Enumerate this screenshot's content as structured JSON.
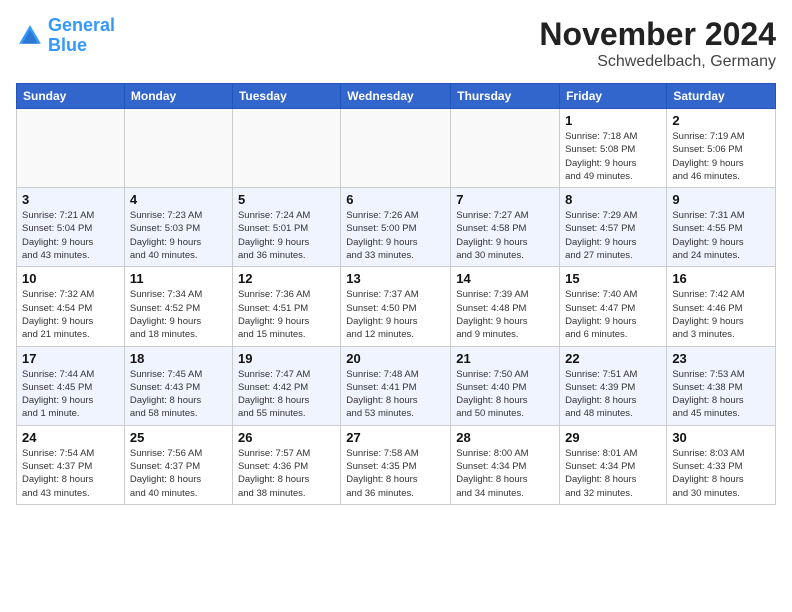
{
  "header": {
    "logo_line1": "General",
    "logo_line2": "Blue",
    "month_title": "November 2024",
    "location": "Schwedelbach, Germany"
  },
  "weekdays": [
    "Sunday",
    "Monday",
    "Tuesday",
    "Wednesday",
    "Thursday",
    "Friday",
    "Saturday"
  ],
  "weeks": [
    [
      {
        "day": "",
        "info": ""
      },
      {
        "day": "",
        "info": ""
      },
      {
        "day": "",
        "info": ""
      },
      {
        "day": "",
        "info": ""
      },
      {
        "day": "",
        "info": ""
      },
      {
        "day": "1",
        "info": "Sunrise: 7:18 AM\nSunset: 5:08 PM\nDaylight: 9 hours\nand 49 minutes."
      },
      {
        "day": "2",
        "info": "Sunrise: 7:19 AM\nSunset: 5:06 PM\nDaylight: 9 hours\nand 46 minutes."
      }
    ],
    [
      {
        "day": "3",
        "info": "Sunrise: 7:21 AM\nSunset: 5:04 PM\nDaylight: 9 hours\nand 43 minutes."
      },
      {
        "day": "4",
        "info": "Sunrise: 7:23 AM\nSunset: 5:03 PM\nDaylight: 9 hours\nand 40 minutes."
      },
      {
        "day": "5",
        "info": "Sunrise: 7:24 AM\nSunset: 5:01 PM\nDaylight: 9 hours\nand 36 minutes."
      },
      {
        "day": "6",
        "info": "Sunrise: 7:26 AM\nSunset: 5:00 PM\nDaylight: 9 hours\nand 33 minutes."
      },
      {
        "day": "7",
        "info": "Sunrise: 7:27 AM\nSunset: 4:58 PM\nDaylight: 9 hours\nand 30 minutes."
      },
      {
        "day": "8",
        "info": "Sunrise: 7:29 AM\nSunset: 4:57 PM\nDaylight: 9 hours\nand 27 minutes."
      },
      {
        "day": "9",
        "info": "Sunrise: 7:31 AM\nSunset: 4:55 PM\nDaylight: 9 hours\nand 24 minutes."
      }
    ],
    [
      {
        "day": "10",
        "info": "Sunrise: 7:32 AM\nSunset: 4:54 PM\nDaylight: 9 hours\nand 21 minutes."
      },
      {
        "day": "11",
        "info": "Sunrise: 7:34 AM\nSunset: 4:52 PM\nDaylight: 9 hours\nand 18 minutes."
      },
      {
        "day": "12",
        "info": "Sunrise: 7:36 AM\nSunset: 4:51 PM\nDaylight: 9 hours\nand 15 minutes."
      },
      {
        "day": "13",
        "info": "Sunrise: 7:37 AM\nSunset: 4:50 PM\nDaylight: 9 hours\nand 12 minutes."
      },
      {
        "day": "14",
        "info": "Sunrise: 7:39 AM\nSunset: 4:48 PM\nDaylight: 9 hours\nand 9 minutes."
      },
      {
        "day": "15",
        "info": "Sunrise: 7:40 AM\nSunset: 4:47 PM\nDaylight: 9 hours\nand 6 minutes."
      },
      {
        "day": "16",
        "info": "Sunrise: 7:42 AM\nSunset: 4:46 PM\nDaylight: 9 hours\nand 3 minutes."
      }
    ],
    [
      {
        "day": "17",
        "info": "Sunrise: 7:44 AM\nSunset: 4:45 PM\nDaylight: 9 hours\nand 1 minute."
      },
      {
        "day": "18",
        "info": "Sunrise: 7:45 AM\nSunset: 4:43 PM\nDaylight: 8 hours\nand 58 minutes."
      },
      {
        "day": "19",
        "info": "Sunrise: 7:47 AM\nSunset: 4:42 PM\nDaylight: 8 hours\nand 55 minutes."
      },
      {
        "day": "20",
        "info": "Sunrise: 7:48 AM\nSunset: 4:41 PM\nDaylight: 8 hours\nand 53 minutes."
      },
      {
        "day": "21",
        "info": "Sunrise: 7:50 AM\nSunset: 4:40 PM\nDaylight: 8 hours\nand 50 minutes."
      },
      {
        "day": "22",
        "info": "Sunrise: 7:51 AM\nSunset: 4:39 PM\nDaylight: 8 hours\nand 48 minutes."
      },
      {
        "day": "23",
        "info": "Sunrise: 7:53 AM\nSunset: 4:38 PM\nDaylight: 8 hours\nand 45 minutes."
      }
    ],
    [
      {
        "day": "24",
        "info": "Sunrise: 7:54 AM\nSunset: 4:37 PM\nDaylight: 8 hours\nand 43 minutes."
      },
      {
        "day": "25",
        "info": "Sunrise: 7:56 AM\nSunset: 4:37 PM\nDaylight: 8 hours\nand 40 minutes."
      },
      {
        "day": "26",
        "info": "Sunrise: 7:57 AM\nSunset: 4:36 PM\nDaylight: 8 hours\nand 38 minutes."
      },
      {
        "day": "27",
        "info": "Sunrise: 7:58 AM\nSunset: 4:35 PM\nDaylight: 8 hours\nand 36 minutes."
      },
      {
        "day": "28",
        "info": "Sunrise: 8:00 AM\nSunset: 4:34 PM\nDaylight: 8 hours\nand 34 minutes."
      },
      {
        "day": "29",
        "info": "Sunrise: 8:01 AM\nSunset: 4:34 PM\nDaylight: 8 hours\nand 32 minutes."
      },
      {
        "day": "30",
        "info": "Sunrise: 8:03 AM\nSunset: 4:33 PM\nDaylight: 8 hours\nand 30 minutes."
      }
    ]
  ]
}
